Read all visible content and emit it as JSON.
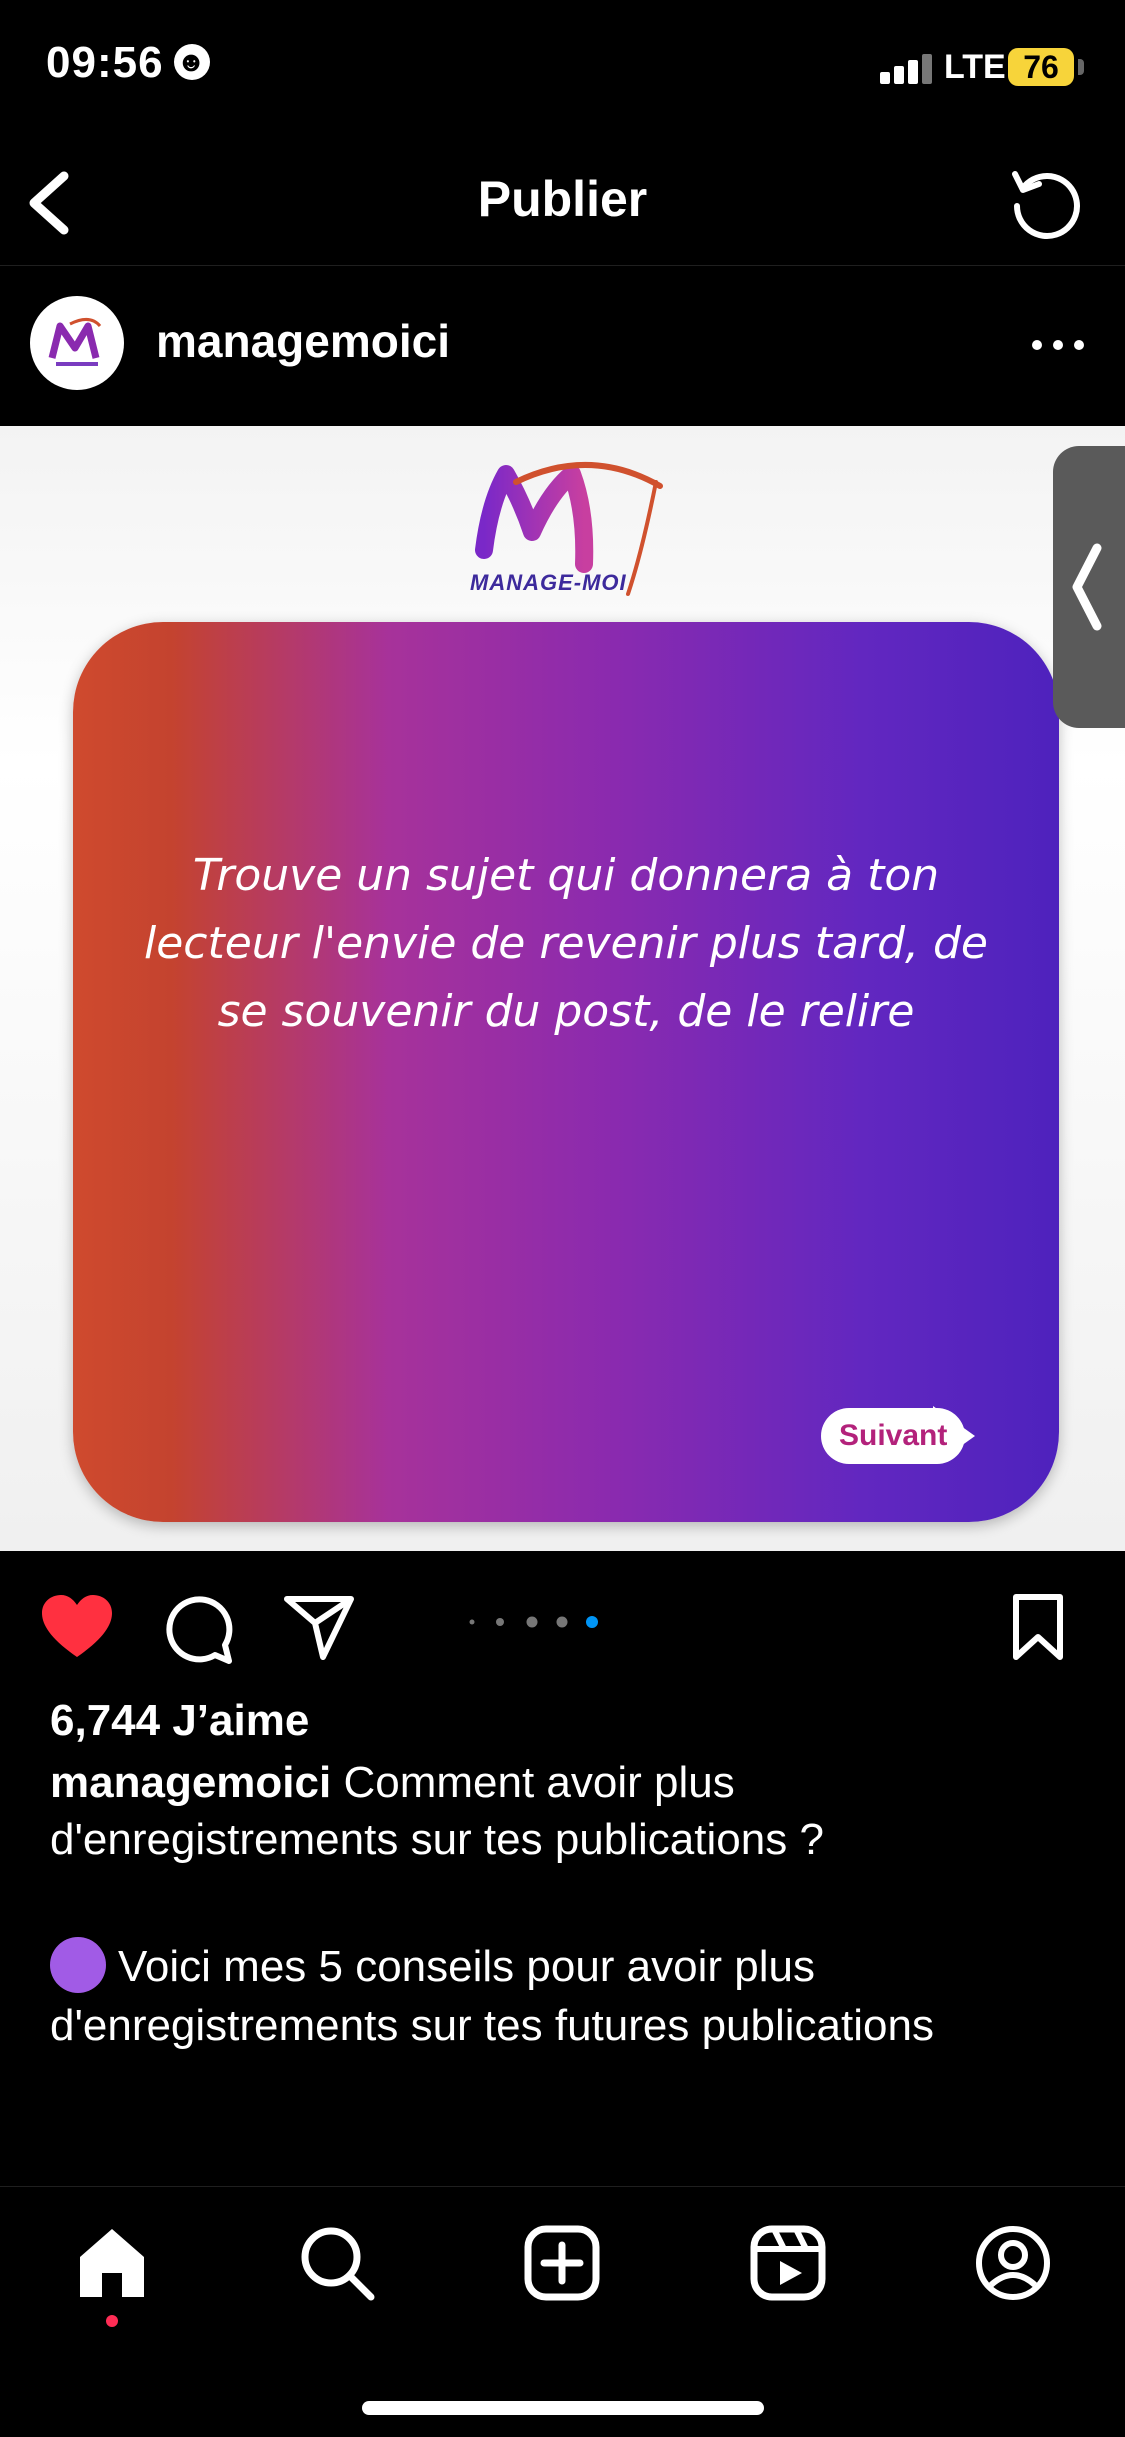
{
  "status_bar": {
    "time": "09:56",
    "emoji": "☻",
    "network": "LTE",
    "battery": "76"
  },
  "header": {
    "title": "Publier"
  },
  "post": {
    "username": "managemoici",
    "logo_text": "MANAGE-MOI",
    "quote": "Trouve un sujet qui donnera à ton lecteur l'envie de revenir plus tard, de se souvenir du post, de le relire",
    "next_label": "Suivant",
    "carousel": {
      "total": 5,
      "active_index": 4
    },
    "likes": "6,744 J’aime",
    "caption_user": "managemoici",
    "caption_text": "Comment avoir plus d'enregistrements sur tes publications ?",
    "tip_text": "Voici mes 5 conseils pour avoir plus d'enregistrements sur tes futures publications",
    "liked": true
  },
  "tabbar": {
    "items": [
      "home-icon",
      "search-icon",
      "new-post-icon",
      "reels-icon",
      "profile-icon"
    ],
    "active": "home-icon"
  },
  "colors": {
    "like_red": "#ff3040",
    "carousel_active": "#0095f6",
    "battery_yellow": "#f7d43a"
  }
}
